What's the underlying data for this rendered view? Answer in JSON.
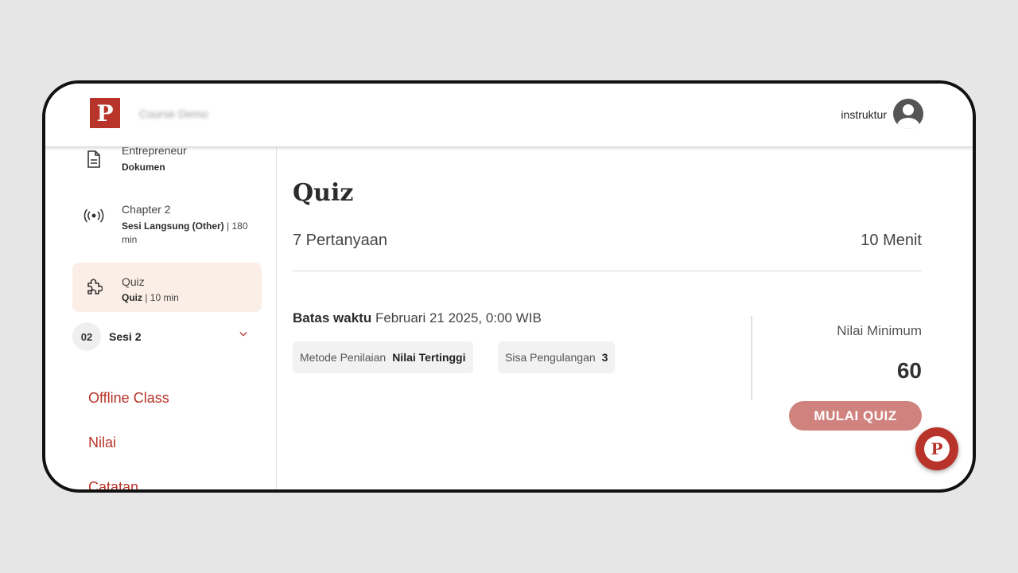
{
  "header": {
    "logo_letter": "P",
    "course_title": "Course Demo",
    "user_name": "instruktur"
  },
  "sidebar": {
    "items": [
      {
        "icon": "document-icon",
        "title": "Entrepreneur",
        "type": "Dokumen",
        "detail": ""
      },
      {
        "icon": "broadcast-icon",
        "title": "Chapter 2",
        "type": "Sesi Langsung (Other)",
        "detail": " | 180 min"
      },
      {
        "icon": "puzzle-icon",
        "title": "Quiz",
        "type": "Quiz",
        "detail": " | 10 min"
      }
    ],
    "session": {
      "number": "02",
      "label": "Sesi 2"
    },
    "links": [
      "Offline Class",
      "Nilai",
      "Catatan"
    ]
  },
  "main": {
    "title": "Quiz",
    "question_count": "7 Pertanyaan",
    "duration": "10 Menit",
    "deadline_label": "Batas waktu",
    "deadline_value": "Februari 21 2025, 0:00 WIB",
    "method_label": "Metode Penilaian",
    "method_value": "Nilai Tertinggi",
    "remaining_label": "Sisa Pengulangan",
    "remaining_value": "3",
    "min_score_label": "Nilai Minimum",
    "min_score_value": "60",
    "start_button": "MULAI QUIZ"
  },
  "colors": {
    "brand": "#b8342a",
    "button": "#d0837e",
    "active_item_bg": "#fbeee6"
  }
}
